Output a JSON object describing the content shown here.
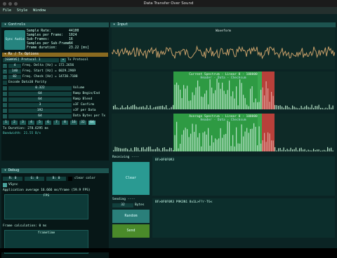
{
  "window": {
    "title": "Data Transfer Over Sound"
  },
  "menu": [
    "File",
    "Style",
    "Window"
  ],
  "controls": {
    "header": "Controls",
    "logo": "Data Transfer Over Sound",
    "logo_short": "Sync Audio",
    "stats": [
      {
        "k": "Sample Rate:",
        "v": "44100"
      },
      {
        "k": "Samples per Frame:",
        "v": "1024"
      },
      {
        "k": "Sub-Frames:",
        "v": "16"
      },
      {
        "k": "Samples per Sub-Frame:",
        "v": "64"
      },
      {
        "k": "Frame duration:",
        "v": "23.22 [ms]"
      }
    ],
    "tab_rx": "Rx / Tx Options",
    "protocol_select": "[GGWAVE] Protocol 1",
    "protocol_label": "Tx Protocol",
    "freq_delta_value": "4",
    "freq_delta_label": "Freq. Delta [Hz] = 172.2656",
    "freq_start_value": "140",
    "freq_start_label": "Freq. Start [Hz] = 6029.2969",
    "freq_check_value": "82",
    "freq_check_label": "Freq. Check [Hz] = 14720.7188",
    "encode_label": "Encode Data10 Parity",
    "sliders": [
      {
        "v": "0.322",
        "l": "Volume"
      },
      {
        "v": "64",
        "l": "Ramp Begin/End"
      },
      {
        "v": "64",
        "l": "Ramp Blend"
      },
      {
        "v": "3",
        "l": "x3F Confirm"
      },
      {
        "v": "192",
        "l": "x3F per Data"
      },
      {
        "v": "64",
        "l": "Data Bytes per Tx"
      }
    ],
    "byte_buttons": [
      "1",
      "2",
      "3",
      "4",
      "5",
      "6",
      "7",
      "8",
      "16",
      "32",
      "64"
    ],
    "tx_duration": "Tx Duration: 278.6295 ms",
    "bandwidth": "Bandwidth:    21.55 B/s"
  },
  "debug": {
    "header": "Debug",
    "chips": [
      "R: 0",
      "G: 0",
      "B: 0"
    ],
    "clear_color": "clear color",
    "vsync": "VSync",
    "app_avg": "Application average 16.666 ms/frame (59.9 FPS)",
    "fps_label": "FPS",
    "frame_calc": "Frame calculation: 0 ms",
    "frametime_label": "frametime"
  },
  "input": {
    "header": "Input",
    "waveform": "Waveform",
    "spectrum_current": "Current Spectrum - Linear 0 - 100000",
    "spectrum_avg": "Average Spectrum - Linear 0 - 100000",
    "spectrum_sub": "Header - Data - Checksum"
  },
  "rx": {
    "receiving_label": "Receiving ----",
    "clear_label": "Clear",
    "rx_text": "BF>0F0F0R3",
    "sending_label": "Sending ----",
    "bytes_value": "32",
    "bytes_unit": "Bytes",
    "random_label": "Random",
    "send_label": "Send",
    "tx_text": "BF>0F0F0R3 P9K3N1 8x1L>F?r-TG<"
  },
  "colors": {
    "accent": "#2a9a92",
    "green": "#34a853",
    "red": "#c0413a",
    "bg": "#0b2424"
  }
}
